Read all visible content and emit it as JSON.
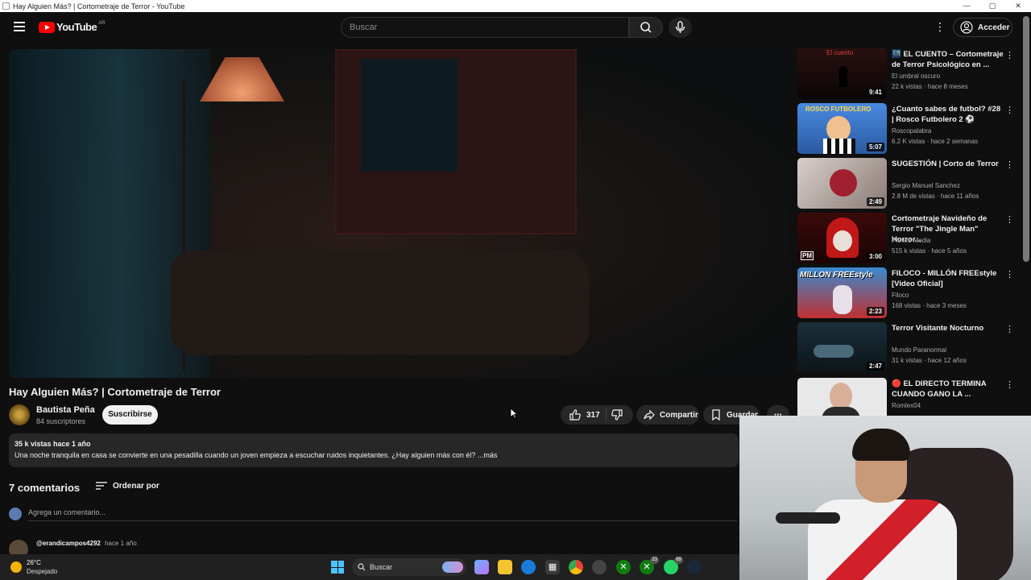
{
  "window": {
    "title": "Hay Alguien Más? | Cortometraje de Terror - YouTube",
    "controls": [
      "—",
      "▢",
      "✕"
    ]
  },
  "masthead": {
    "logo_word": "YouTube",
    "country_code": "AR",
    "search_placeholder": "Buscar",
    "login_label": "Acceder"
  },
  "video": {
    "title": "Hay Alguien Más? | Cortometraje de Terror",
    "channel_name": "Bautista Peña",
    "channel_subs": "84 suscriptores",
    "subscribe_label": "Suscribirse",
    "likes": "317",
    "share_label": "Compartir",
    "save_label": "Guardar",
    "views_time": "35 k vistas  hace 1 año",
    "description": "Una noche tranquila en casa se convierte en una pesadilla cuando un joven empieza a escuchar ruidos inquietantes. ¿Hay alguien más con él? ...más"
  },
  "comments": {
    "count_label": "7 comentarios",
    "sort_label": "Ordenar por",
    "input_placeholder": "Agrega un comentario...",
    "first_author": "@erandicampos4292",
    "first_time": "hace 1 año"
  },
  "recommendations": [
    {
      "title": "🌃 EL CUENTO – Cortometraje de Terror Psicológico en ...",
      "channel": "El umbral oscuro",
      "meta": "22 k vistas · hace 8 meses",
      "duration": "9:41",
      "thumb_label": "El cuento",
      "color": "#1a0e0e"
    },
    {
      "title": "¿Cuanto sabes de futbol? #28 | Rosco Futbolero 2 ⚽",
      "channel": "Roscopalabra",
      "meta": "6.2 K vistas · hace 2 semanas",
      "duration": "5:07",
      "thumb_label": "ROSCO FUTBOLERO",
      "color": "#3a7ad0"
    },
    {
      "title": "SUGESTIÓN | Corto de Terror",
      "channel": "Sergio Manuel Sanchez",
      "meta": "2.8 M de vistas · hace 11 años",
      "duration": "2:49",
      "thumb_label": "",
      "color": "#b8a6a0"
    },
    {
      "title": "Cortometraje Navideño de Terror \"The Jingle Man\" Horror...",
      "channel": "Pánico Media",
      "meta": "515 k vistas · hace 5 años",
      "duration": "3:00",
      "thumb_label": "PM",
      "color": "#5a1414"
    },
    {
      "title": "FILOCO - MILLÓN FREEstyle [Video Oficial]",
      "channel": "Filoco",
      "meta": "168 vistas · hace 3 meses",
      "duration": "2:23",
      "thumb_label": "MILLON FREEstyle",
      "color": "#2a6a9a"
    },
    {
      "title": "Terror    Visitante Nocturno",
      "channel": "Mundo Paranormal",
      "meta": "31 k vistas · hace 12 años",
      "duration": "2:47",
      "thumb_label": "",
      "color": "#1a2a34"
    },
    {
      "title": "🔴 EL DIRECTO TERMINA CUANDO GANO LA ...",
      "channel": "Romlex04",
      "meta": "",
      "duration": "",
      "thumb_label": "",
      "color": "#e8e8e8"
    }
  ],
  "taskbar": {
    "temp": "26°C",
    "weather": "Despejado",
    "search_label": "Buscar",
    "badge_a": "23",
    "badge_b": "69"
  },
  "colors": {
    "background": "#0f0f0f",
    "accent_red": "#ff0000",
    "pill": "#272727"
  }
}
